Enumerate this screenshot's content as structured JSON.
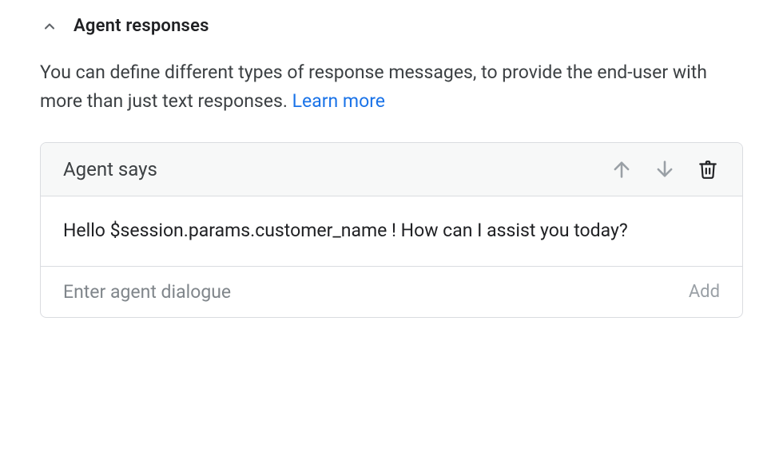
{
  "section": {
    "title": "Agent responses",
    "description_before": "You can define different types of response messages, to provide the end-user with more than just text responses. ",
    "learn_more": "Learn more"
  },
  "card": {
    "header_title": "Agent says",
    "response_text": "Hello $session.params.customer_name ! How can I assist you today?",
    "input_placeholder": "Enter agent dialogue",
    "add_button": "Add"
  }
}
